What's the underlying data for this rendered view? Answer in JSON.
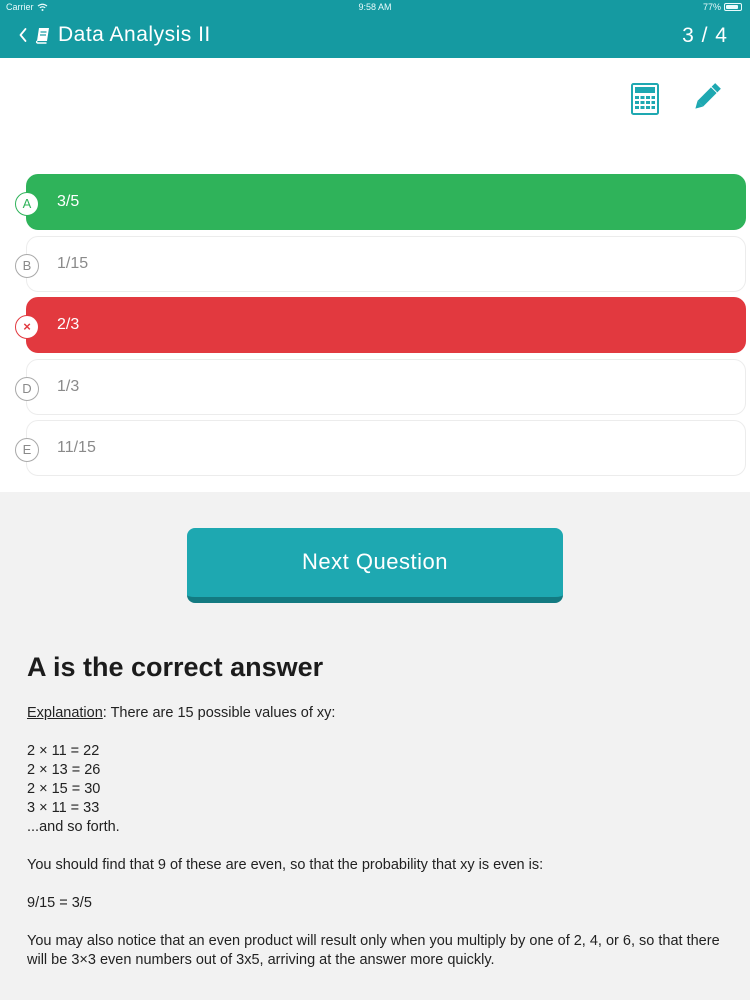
{
  "status_bar": {
    "carrier": "Carrier",
    "time": "9:58 AM",
    "battery": "77%"
  },
  "nav": {
    "back_icon": "chevron-left-icon",
    "title_icon": "book-icon",
    "title": "Data Analysis II",
    "counter": "3 / 4"
  },
  "tools": {
    "calculator_icon": "calculator-icon",
    "pencil_icon": "pencil-icon"
  },
  "choices": [
    {
      "letter": "A",
      "text": "3/5",
      "state": "correct"
    },
    {
      "letter": "B",
      "text": "1/15",
      "state": "neutral"
    },
    {
      "letter": "C",
      "text": "2/3",
      "state": "wrong",
      "badge_symbol": "×"
    },
    {
      "letter": "D",
      "text": "1/3",
      "state": "neutral"
    },
    {
      "letter": "E",
      "text": "11/15",
      "state": "neutral"
    }
  ],
  "next_button": {
    "label": "Next Question"
  },
  "result": {
    "heading": "A is the correct answer"
  },
  "explanation": {
    "label": "Explanation",
    "intro": ": There are 15 possible values of xy:",
    "lines": [
      "2 × 11 = 22",
      "2 × 13 = 26",
      "2 × 15 = 30",
      "3 × 11 = 33",
      "...and so forth."
    ],
    "paragraph1": "You should find that 9 of these are even, so that the probability that xy is even is:",
    "formula": "9/15 = 3/5",
    "paragraph2": "You may also notice that an even product will result only when you multiply by one of 2, 4, or 6, so that there will be 3×3 even numbers out of 3x5, arriving at the answer more quickly."
  },
  "colors": {
    "teal": "#159aa1",
    "button": "#1ea8b1",
    "correct": "#2fb35a",
    "wrong": "#e2393f"
  }
}
